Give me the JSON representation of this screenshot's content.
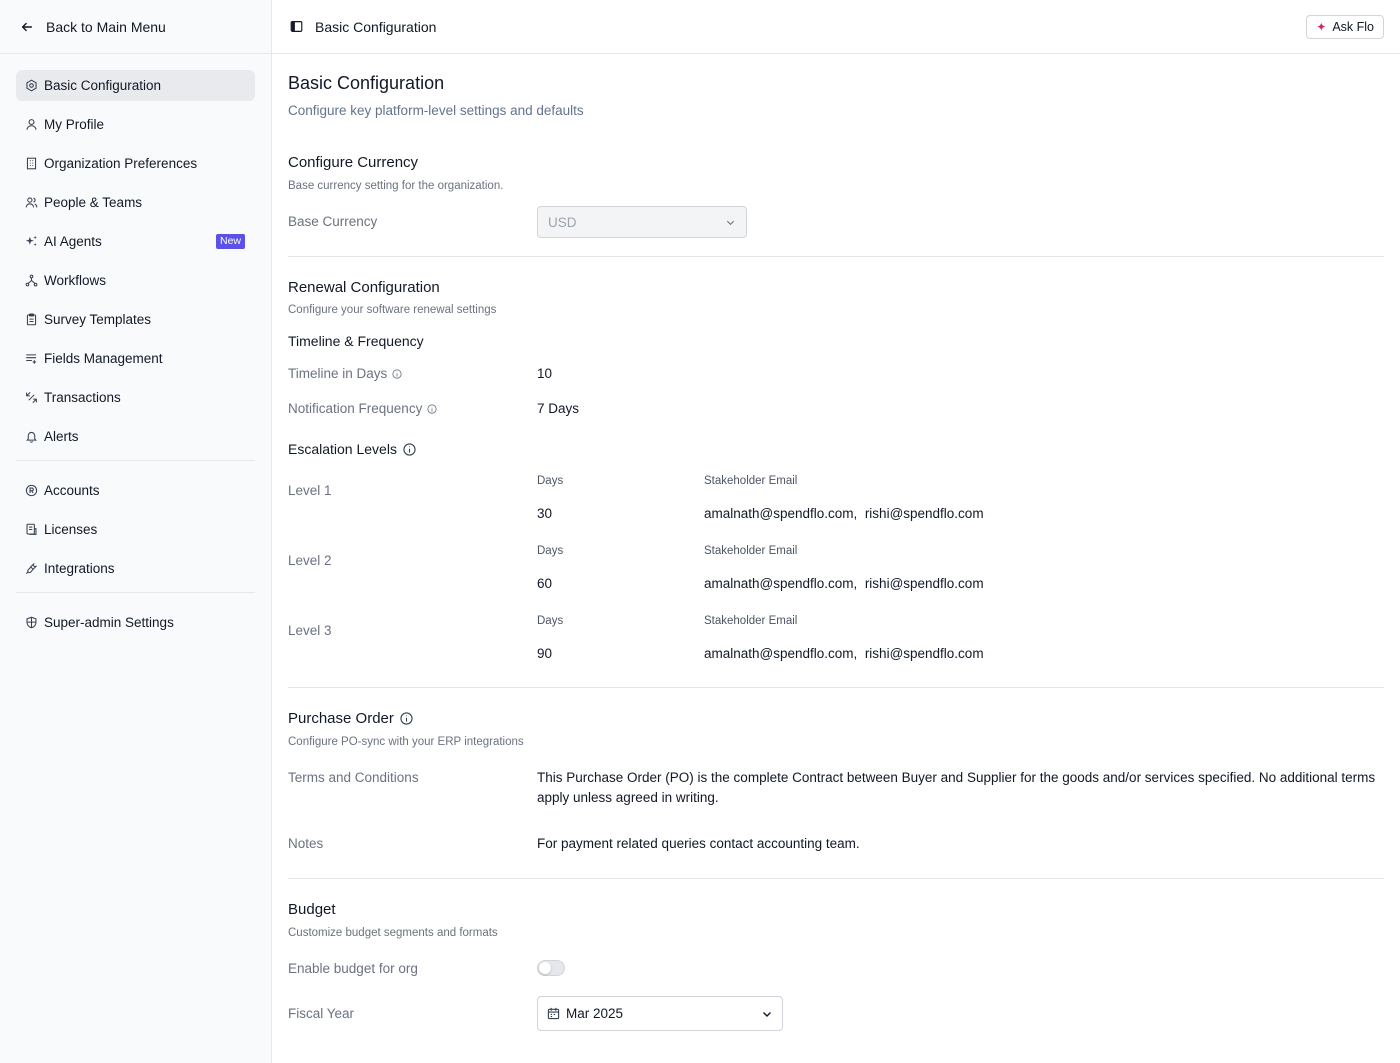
{
  "sidebar": {
    "back_label": "Back to Main Menu",
    "group1": [
      {
        "label": "Basic Configuration",
        "icon": "hexagon-settings-icon",
        "active": true
      },
      {
        "label": "My Profile",
        "icon": "user-icon"
      },
      {
        "label": "Organization Preferences",
        "icon": "building-icon"
      },
      {
        "label": "People & Teams",
        "icon": "users-icon"
      },
      {
        "label": "AI Agents",
        "icon": "sparkles-icon",
        "badge": "New"
      },
      {
        "label": "Workflows",
        "icon": "workflow-icon"
      },
      {
        "label": "Survey Templates",
        "icon": "clipboard-icon"
      },
      {
        "label": "Fields Management",
        "icon": "list-plus-icon"
      },
      {
        "label": "Transactions",
        "icon": "arrows-icon"
      },
      {
        "label": "Alerts",
        "icon": "bell-icon"
      }
    ],
    "group2": [
      {
        "label": "Accounts",
        "icon": "account-circle-icon"
      },
      {
        "label": "Licenses",
        "icon": "license-icon"
      },
      {
        "label": "Integrations",
        "icon": "plug-icon"
      }
    ],
    "group3": [
      {
        "label": "Super-admin Settings",
        "icon": "shield-icon"
      }
    ]
  },
  "header": {
    "title": "Basic Configuration",
    "ask_label": "Ask Flo"
  },
  "page": {
    "title": "Basic Configuration",
    "subtitle": "Configure key platform-level settings and defaults"
  },
  "currency": {
    "title": "Configure Currency",
    "subtitle": "Base currency setting for the organization.",
    "label": "Base Currency",
    "value": "USD"
  },
  "renewal": {
    "title": "Renewal Configuration",
    "subtitle": "Configure your software renewal settings",
    "timeline_heading": "Timeline & Frequency",
    "timeline_label": "Timeline in Days",
    "timeline_value": "10",
    "frequency_label": "Notification Frequency",
    "frequency_value": "7 Days",
    "escalation_heading": "Escalation Levels",
    "days_header": "Days",
    "email_header": "Stakeholder Email",
    "levels": [
      {
        "label": "Level 1",
        "days": "30",
        "email1": "amalnath@spendflo.com,",
        "email2": "rishi@spendflo.com"
      },
      {
        "label": "Level 2",
        "days": "60",
        "email1": "amalnath@spendflo.com,",
        "email2": "rishi@spendflo.com"
      },
      {
        "label": "Level 3",
        "days": "90",
        "email1": "amalnath@spendflo.com,",
        "email2": "rishi@spendflo.com"
      }
    ]
  },
  "purchase_order": {
    "title": "Purchase Order",
    "subtitle": "Configure PO-sync with your ERP integrations",
    "terms_label": "Terms and Conditions",
    "terms_value": "This Purchase Order (PO) is the complete Contract between Buyer and Supplier for the goods and/or services specified. No additional terms apply unless agreed in writing.",
    "notes_label": "Notes",
    "notes_value": "For payment related queries contact accounting team."
  },
  "budget": {
    "title": "Budget",
    "subtitle": "Customize budget segments and formats",
    "enable_label": "Enable budget for org",
    "enabled": false,
    "fiscal_label": "Fiscal Year",
    "fiscal_value": "Mar 2025"
  },
  "colors": {
    "accent": "#5b50e8",
    "ask_spark": "#d6246e",
    "sidebar_bg": "#f9fafb",
    "active_bg": "#e9eaee"
  }
}
